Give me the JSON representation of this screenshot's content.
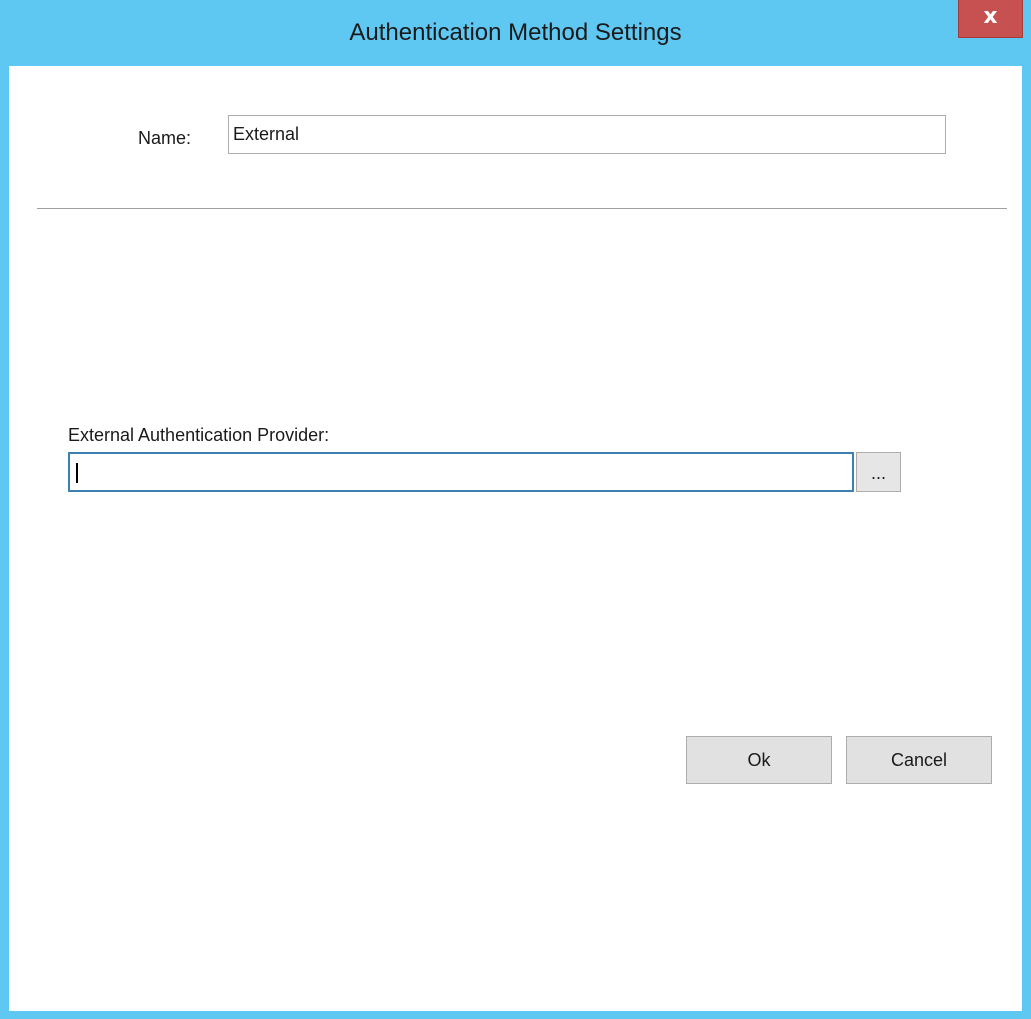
{
  "window": {
    "title": "Authentication Method Settings",
    "close_glyph": "x",
    "accent_color": "#5ec7f2",
    "close_color": "#c75050"
  },
  "form": {
    "name_label": "Name:",
    "name_value": "External",
    "provider_label": "External Authentication Provider:",
    "provider_value": "",
    "browse_label": "..."
  },
  "buttons": {
    "ok_label": "Ok",
    "cancel_label": "Cancel"
  }
}
